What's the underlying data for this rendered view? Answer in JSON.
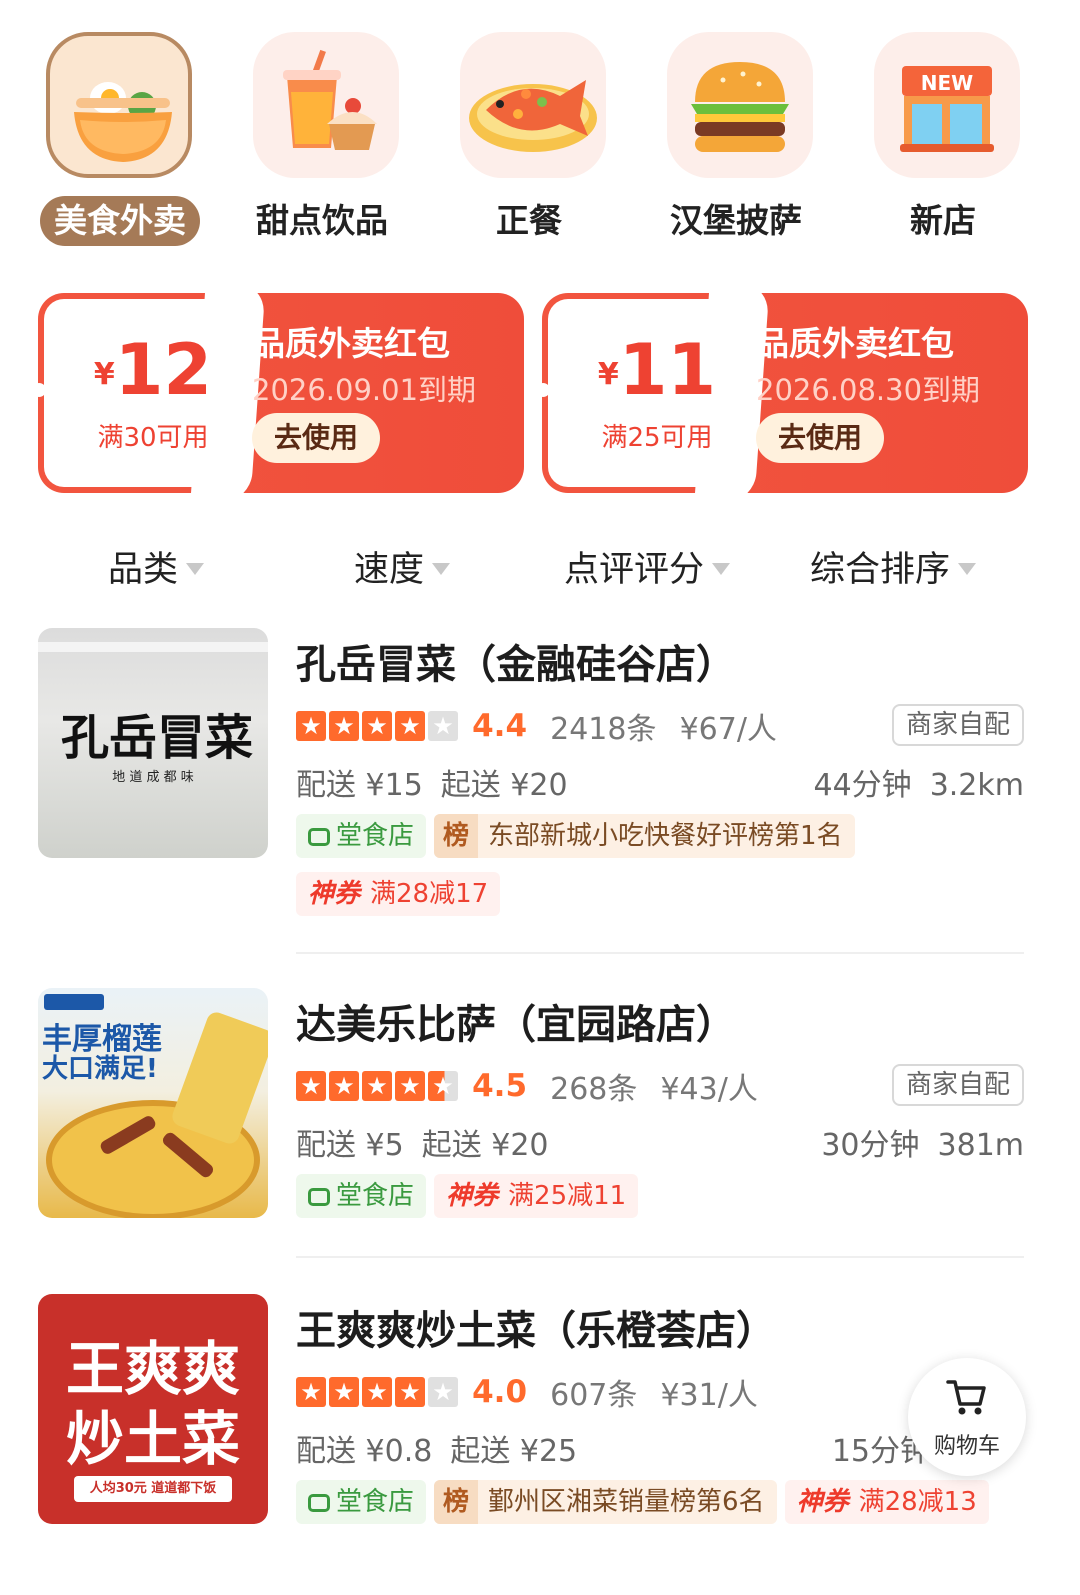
{
  "categories": [
    {
      "label": "美食外卖",
      "icon": "noodle-bowl-icon",
      "active": true
    },
    {
      "label": "甜点饮品",
      "icon": "drink-cake-icon",
      "active": false
    },
    {
      "label": "正餐",
      "icon": "fish-dish-icon",
      "active": false
    },
    {
      "label": "汉堡披萨",
      "icon": "burger-icon",
      "active": false
    },
    {
      "label": "新店",
      "icon": "new-store-icon",
      "active": false
    }
  ],
  "coupons": [
    {
      "yen": "¥",
      "amount": "12",
      "condition": "满30可用",
      "title": "品质外卖红包",
      "expiry": "2026.09.01到期",
      "button": "去使用"
    },
    {
      "yen": "¥",
      "amount": "11",
      "condition": "满25可用",
      "title": "品质外卖红包",
      "expiry": "2026.08.30到期",
      "button": "去使用"
    }
  ],
  "filters": [
    {
      "label": "品类"
    },
    {
      "label": "速度"
    },
    {
      "label": "点评评分"
    },
    {
      "label": "综合排序"
    }
  ],
  "stores": [
    {
      "name": "孔岳冒菜（金融硅谷店）",
      "thumb_text": "孔岳冒菜",
      "thumb_sub": "地 道 成 都 味",
      "rating": 4.4,
      "score": "4.4",
      "reviews": "2418条",
      "per_person": "¥67/人",
      "self_delivery": "商家自配",
      "delivery_fee": "配送 ¥15",
      "min_order": "起送 ¥20",
      "eta": "44分钟",
      "distance": "3.2km",
      "dine_tag": "堂食店",
      "rank_icon": "榜",
      "rank_tag": "东部新城小吃快餐好评榜第1名",
      "deal_label": "神券",
      "deal": "满28减17"
    },
    {
      "name": "达美乐比萨（宜园路店）",
      "thumb_text": "丰厚榴莲",
      "thumb_sub": "大口满足!",
      "rating": 4.5,
      "score": "4.5",
      "reviews": "268条",
      "per_person": "¥43/人",
      "self_delivery": "商家自配",
      "delivery_fee": "配送 ¥5",
      "min_order": "起送 ¥20",
      "eta": "30分钟",
      "distance": "381m",
      "dine_tag": "堂食店",
      "deal_label": "神券",
      "deal": "满25减11"
    },
    {
      "name": "王爽爽炒土菜（乐橙荟店）",
      "thumb_text": "王爽爽",
      "thumb_text2": "炒土菜",
      "thumb_sub": "人均30元  道道都下饭",
      "rating": 4.0,
      "score": "4.0",
      "reviews": "607条",
      "per_person": "¥31/人",
      "delivery_fee": "配送 ¥0.8",
      "min_order": "起送 ¥25",
      "eta": "15分钟",
      "dine_tag": "堂食店",
      "rank_icon": "榜",
      "rank_tag": "鄞州区湘菜销量榜第6名",
      "deal_label": "神券",
      "deal": "满28减13"
    }
  ],
  "cart": {
    "label": "购物车"
  },
  "colors": {
    "accent": "#ff6a2c",
    "coupon_red": "#ef4d3a",
    "active_chip": "#a57a57",
    "dine_green": "#3a9a3f"
  }
}
